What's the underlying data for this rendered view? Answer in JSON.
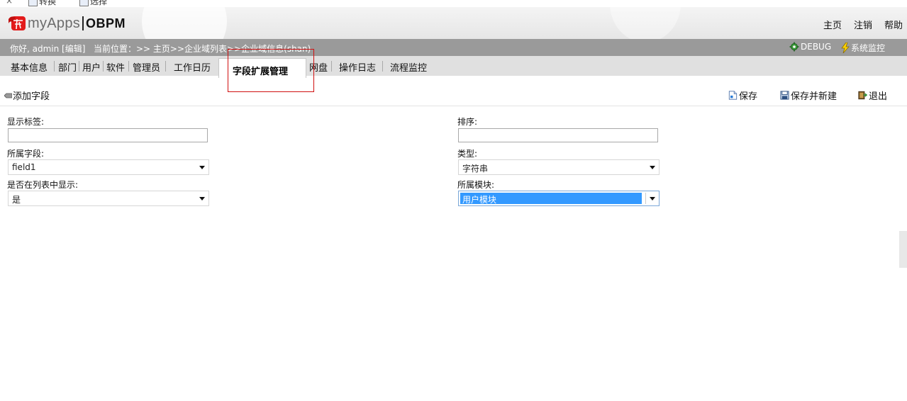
{
  "browser_strip": {
    "close_glyph": "×",
    "item1": "转换",
    "item2": "选择"
  },
  "header": {
    "logo_brand": "myApps",
    "logo_product": "OBPM",
    "links": {
      "home": "主页",
      "logout": "注销",
      "help": "帮助"
    }
  },
  "infobar": {
    "greeting": "你好, admin [编辑]",
    "breadcrumb": "当前位置：>> 主页>>企业域列表>>企业域信息(shan)",
    "debug": "DEBUG",
    "monitor": "系统监控"
  },
  "tabs": {
    "basic": "基本信息",
    "dept": "部门",
    "user": "用户",
    "software": "软件",
    "admin": "管理员",
    "calendar": "工作日历",
    "fields": "字段扩展管理",
    "disk": "网盘",
    "oplog": "操作日志",
    "flowmon": "流程监控"
  },
  "toolbar": {
    "title": "添加字段",
    "save": "保存",
    "save_new": "保存并新建",
    "exit": "退出"
  },
  "form": {
    "display_label": {
      "label": "显示标签:",
      "value": ""
    },
    "sort": {
      "label": "排序:",
      "value": ""
    },
    "field": {
      "label": "所属字段:",
      "value": "field1"
    },
    "type": {
      "label": "类型:",
      "value": "字符串"
    },
    "show_in_list": {
      "label": "是否在列表中显示:",
      "value": "是"
    },
    "module": {
      "label": "所属模块:",
      "value": "用户模块"
    }
  },
  "colors": {
    "infobar_bg": "#9a9a9a",
    "tabbar_bg": "#e0e0e0",
    "highlight": "#3399ff",
    "annotation_red": "#d01010"
  }
}
